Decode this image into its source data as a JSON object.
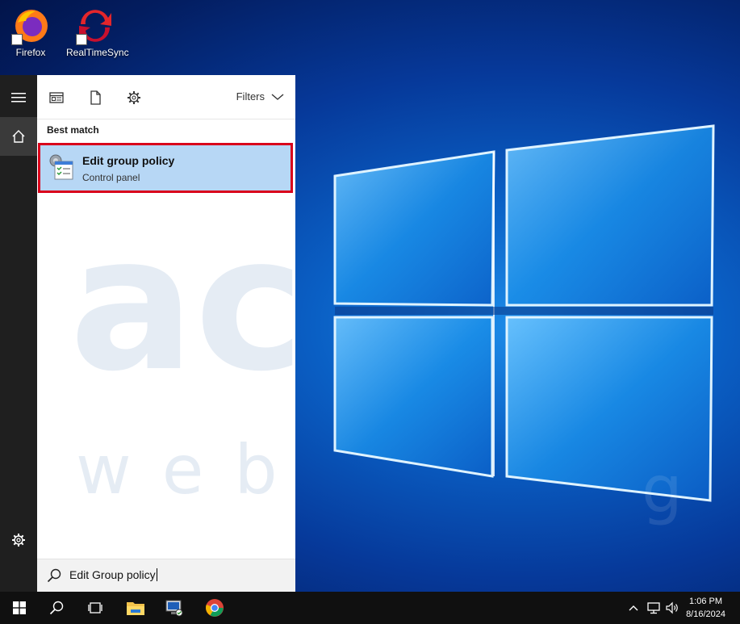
{
  "desktop": {
    "icons": [
      {
        "label": "Firefox",
        "icon": "firefox-icon"
      },
      {
        "label": "RealTimeSync",
        "icon": "realtimesync-icon"
      }
    ],
    "watermark": {
      "big": "ac",
      "word": "web",
      "tail": "g"
    }
  },
  "start_menu": {
    "rail": {
      "items": [
        "hamburger-icon",
        "home-icon",
        "settings-icon"
      ]
    },
    "toolbar": {
      "filters_label": "Filters"
    },
    "best_match_label": "Best match",
    "result": {
      "title": "Edit group policy",
      "subtitle": "Control panel",
      "icon": "group-policy-icon"
    },
    "search": {
      "value": "Edit Group policy"
    }
  },
  "taskbar": {
    "items": [
      "start-icon",
      "search-icon",
      "task-view-icon",
      "file-explorer-icon",
      "server-manager-icon",
      "chrome-icon"
    ],
    "tray": [
      "chevron-up-icon",
      "network-icon",
      "volume-icon"
    ],
    "clock": {
      "time": "1:06 PM",
      "date": "8/16/2024"
    }
  },
  "colors": {
    "highlight": "#b7d7f5",
    "outline": "#d9001b",
    "rail": "#1f1f1f",
    "taskbar": "#101010"
  }
}
